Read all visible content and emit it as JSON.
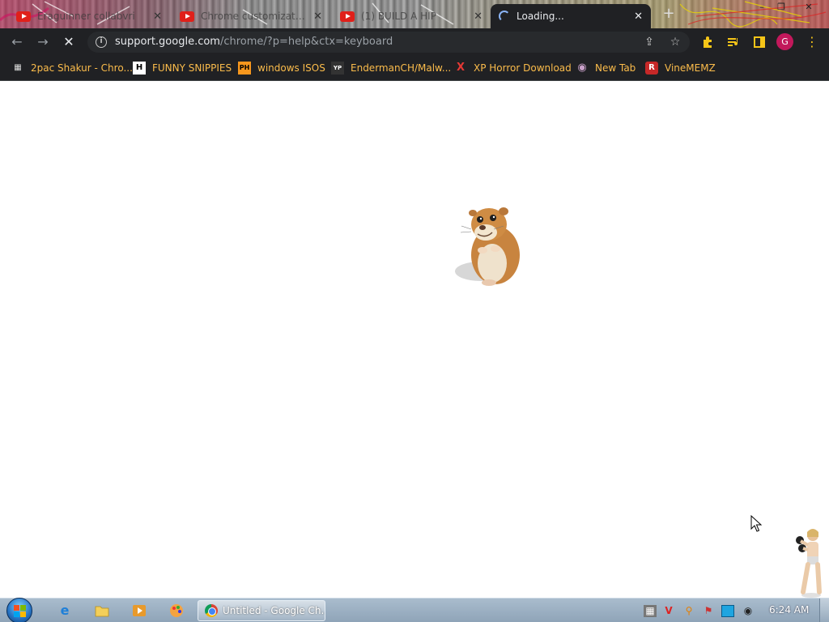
{
  "tabs": [
    {
      "title": "Eraguinner collabvri",
      "icon": "youtube-icon",
      "active": false
    },
    {
      "title": "Chrome customization",
      "icon": "youtube-icon",
      "active": false
    },
    {
      "title": "(1) BUILD A HIP",
      "icon": "youtube-icon",
      "active": false
    },
    {
      "title": "Loading...",
      "icon": "loading-spinner-icon",
      "active": true
    }
  ],
  "new_tab_label": "+",
  "window_controls": {
    "minimize": "–",
    "restore": "❐",
    "close": "✕"
  },
  "toolbar": {
    "back": "←",
    "forward": "→",
    "stop": "✕",
    "url_host": "support.google.com",
    "url_path": "/chrome/?p=help&ctx=keyboard",
    "share_icon": "⇪",
    "star_icon": "☆",
    "avatar_letter": "G"
  },
  "bookmarks": [
    {
      "label": "2pac Shakur - Chro...",
      "icon": "calendar-icon",
      "glyph": "▦"
    },
    {
      "label": "FUNNY SNIPPIES",
      "icon": "h-icon",
      "glyph": "H"
    },
    {
      "label": "windows ISOS",
      "icon": "ph-icon",
      "glyph": "PH"
    },
    {
      "label": "EndermanCH/Malw...",
      "icon": "yp-icon",
      "glyph": "YP"
    },
    {
      "label": "XP Horror Download",
      "icon": "x-icon",
      "glyph": "X"
    },
    {
      "label": "New Tab",
      "icon": "globe-icon",
      "glyph": "◉"
    },
    {
      "label": "VineMEMZ",
      "icon": "r-icon",
      "glyph": "R"
    }
  ],
  "taskbar": {
    "chrome_window_label": "Untitled - Google Ch...",
    "clock": "6:24 AM"
  },
  "colors": {
    "chrome_dark": "#202124",
    "bookmark_text": "#fbbc4b",
    "avatar": "#c2185b",
    "taskbar": "#9fb3c6"
  }
}
